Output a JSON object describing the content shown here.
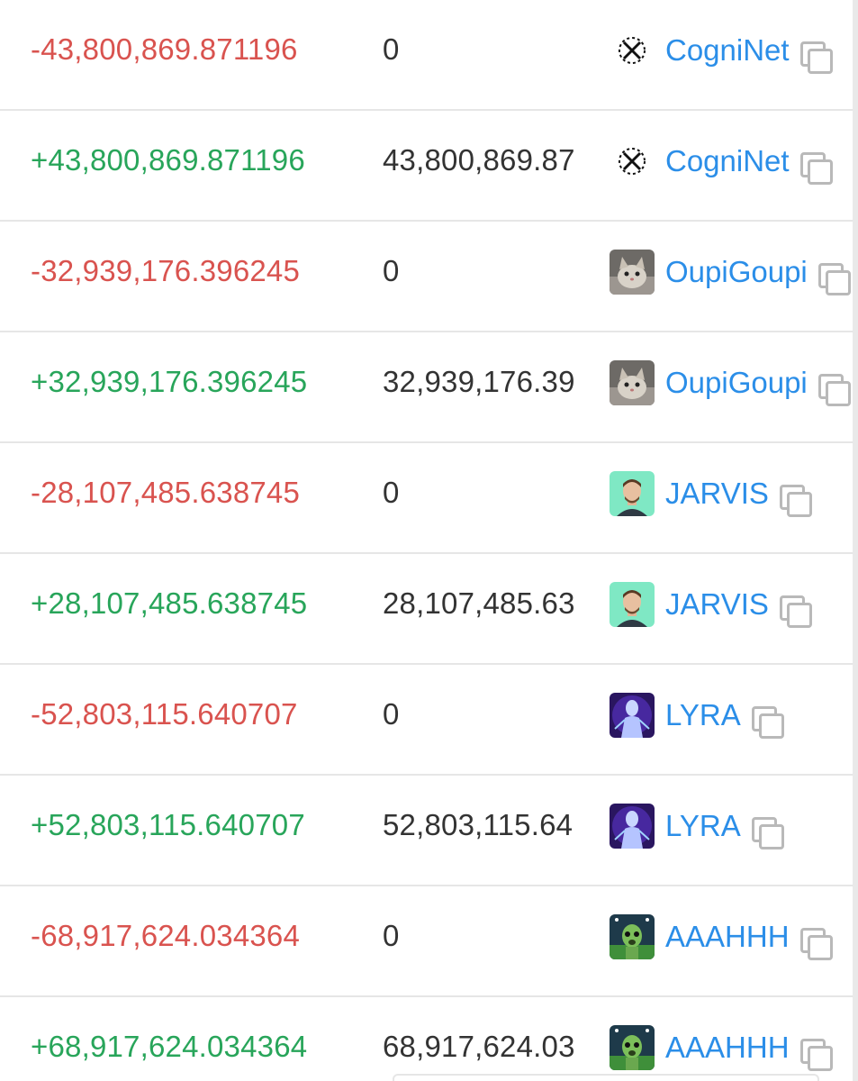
{
  "transfers": [
    {
      "amount": "-43,800,869.871196",
      "direction": "out",
      "balance": "0",
      "owner": "CogniNet",
      "avatar": "crossed-circle-logo-icon"
    },
    {
      "amount": "+43,800,869.871196",
      "direction": "in",
      "balance": "43,800,869.87",
      "owner": "CogniNet",
      "avatar": "crossed-circle-logo-icon"
    },
    {
      "amount": "-32,939,176.396245",
      "direction": "out",
      "balance": "0",
      "owner": "OupiGoupi",
      "avatar": "cat-avatar-icon"
    },
    {
      "amount": "+32,939,176.396245",
      "direction": "in",
      "balance": "32,939,176.39",
      "owner": "OupiGoupi",
      "avatar": "cat-avatar-icon"
    },
    {
      "amount": "-28,107,485.638745",
      "direction": "out",
      "balance": "0",
      "owner": "JARVIS",
      "avatar": "man-portrait-avatar-icon"
    },
    {
      "amount": "+28,107,485.638745",
      "direction": "in",
      "balance": "28,107,485.63",
      "owner": "JARVIS",
      "avatar": "man-portrait-avatar-icon"
    },
    {
      "amount": "-52,803,115.640707",
      "direction": "out",
      "balance": "0",
      "owner": "LYRA",
      "avatar": "glowing-humanoid-avatar-icon"
    },
    {
      "amount": "+52,803,115.640707",
      "direction": "in",
      "balance": "52,803,115.64",
      "owner": "LYRA",
      "avatar": "glowing-humanoid-avatar-icon"
    },
    {
      "amount": "-68,917,624.034364",
      "direction": "out",
      "balance": "0",
      "owner": "AAAHHH",
      "avatar": "alien-stadium-avatar-icon"
    },
    {
      "amount": "+68,917,624.034364",
      "direction": "in",
      "balance": "68,917,624.03",
      "owner": "AAAHHH",
      "avatar": "alien-stadium-avatar-icon"
    }
  ],
  "colors": {
    "negative": "#d9534f",
    "positive": "#28a55a",
    "link": "#2b8ee8",
    "text": "#333333",
    "divider": "#e6e6e6"
  }
}
